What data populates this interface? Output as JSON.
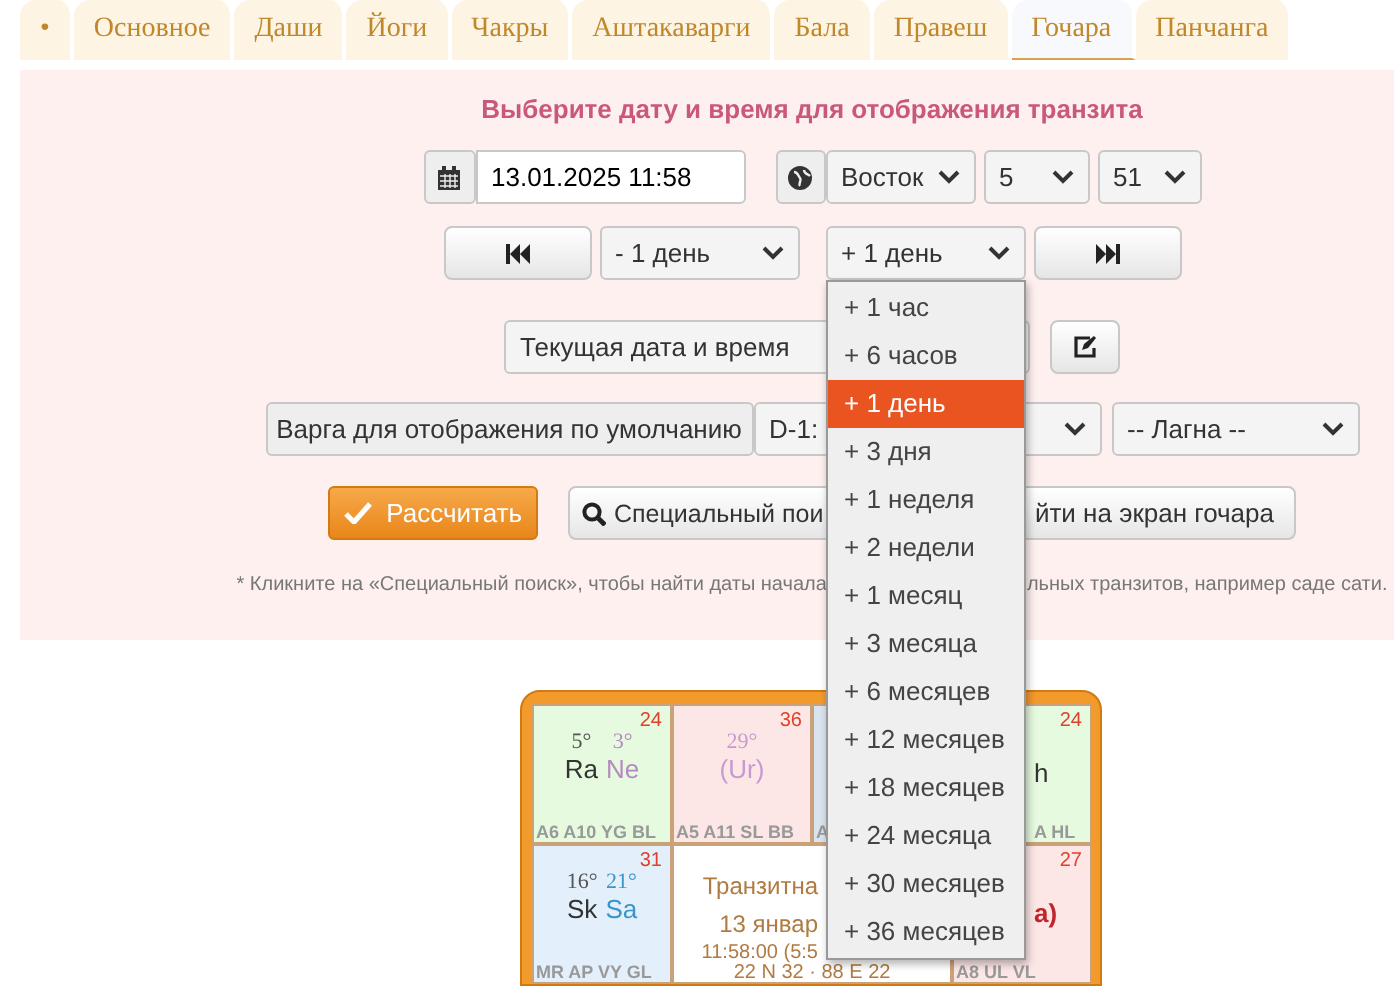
{
  "tabs": [
    {
      "label": "•",
      "selected": false
    },
    {
      "label": "Основное",
      "selected": false
    },
    {
      "label": "Даши",
      "selected": false
    },
    {
      "label": "Йоги",
      "selected": false
    },
    {
      "label": "Чакры",
      "selected": false
    },
    {
      "label": "Аштакаварги",
      "selected": false
    },
    {
      "label": "Бала",
      "selected": false
    },
    {
      "label": "Правеш",
      "selected": false
    },
    {
      "label": "Гочара",
      "selected": true
    },
    {
      "label": "Панчанга",
      "selected": false
    }
  ],
  "transit": {
    "title": "Выберите дату и время для отображения транзита",
    "datetime": {
      "value": "13.01.2025 11:58"
    },
    "direction": "Восток",
    "hours": "5",
    "minutes": "51",
    "back_step": "- 1 день",
    "forward_step": "+ 1 день",
    "preset": "Текущая дата и время",
    "varga_label": "Варга для отображения по умолчанию",
    "varga": "D-1:",
    "lagna": "-- Лагна --",
    "calculate": "Рассчитать",
    "special_search": "Специальный пои",
    "goto_gochara": "йти на экран гочара",
    "hint": [
      "* Кликните на «Специальный поиск», чтобы найти даты начала",
      "льных транзитов, например саде сати."
    ]
  },
  "step_menu": {
    "options": [
      {
        "label": "+ 1 час",
        "selected": false
      },
      {
        "label": "+ 6 часов",
        "selected": false
      },
      {
        "label": "+ 1 день",
        "selected": true
      },
      {
        "label": "+ 3 дня",
        "selected": false
      },
      {
        "label": "+ 1 неделя",
        "selected": false
      },
      {
        "label": "+ 2 недели",
        "selected": false
      },
      {
        "label": "+ 1 месяц",
        "selected": false
      },
      {
        "label": "+ 3 месяца",
        "selected": false
      },
      {
        "label": "+ 6 месяцев",
        "selected": false
      },
      {
        "label": "+ 12 месяцев",
        "selected": false
      },
      {
        "label": "+ 18 месяцев",
        "selected": false
      },
      {
        "label": "+ 24 месяца",
        "selected": false
      },
      {
        "label": "+ 30 месяцев",
        "selected": false
      },
      {
        "label": "+ 36 месяцев",
        "selected": false
      }
    ]
  },
  "chart": {
    "cells": [
      {
        "kind": "full",
        "color": "#e6fadf",
        "number": "24",
        "planets": [
          {
            "degree": "5°",
            "name": "Ra",
            "color": "#333333"
          },
          {
            "degree": "3°",
            "name": "Ne",
            "color": "#b58ac0"
          }
        ],
        "tags": "A6 A10 YG BL"
      },
      {
        "kind": "full",
        "color": "#fde6e6",
        "number": "36",
        "planets": [
          {
            "degree": "29°",
            "name": "(Ur)",
            "color": "#c79ad0"
          }
        ],
        "tags": "A5 A11 SL BB"
      },
      {
        "kind": "full",
        "color": "#d9e4ef",
        "tags": "A"
      },
      {
        "kind": "partial",
        "color": "#e6fadf",
        "number": "24",
        "planets": [
          {
            "name": "h",
            "color": "#333333"
          }
        ],
        "tags": "A HL"
      },
      {
        "kind": "full",
        "color": "#e3f0fc",
        "number": "31",
        "planets": [
          {
            "degree": "16°",
            "name": "Sk",
            "color": "#333333"
          },
          {
            "degree": "21°",
            "name": "Sa",
            "color": "#3a95c9"
          }
        ],
        "tags": "MR AP VY GL"
      },
      {
        "kind": "center",
        "lines": [
          "Транзитна",
          "13 январ",
          "11:58:00 (5:5",
          "22 N 32 · 88 E 22"
        ]
      },
      {
        "kind": "partial_top",
        "color": "#fde6e6",
        "number": "27",
        "planets": [
          {
            "name": "a)",
            "color": "#c0262d"
          }
        ],
        "tags": "A8 UL VL"
      }
    ]
  }
}
